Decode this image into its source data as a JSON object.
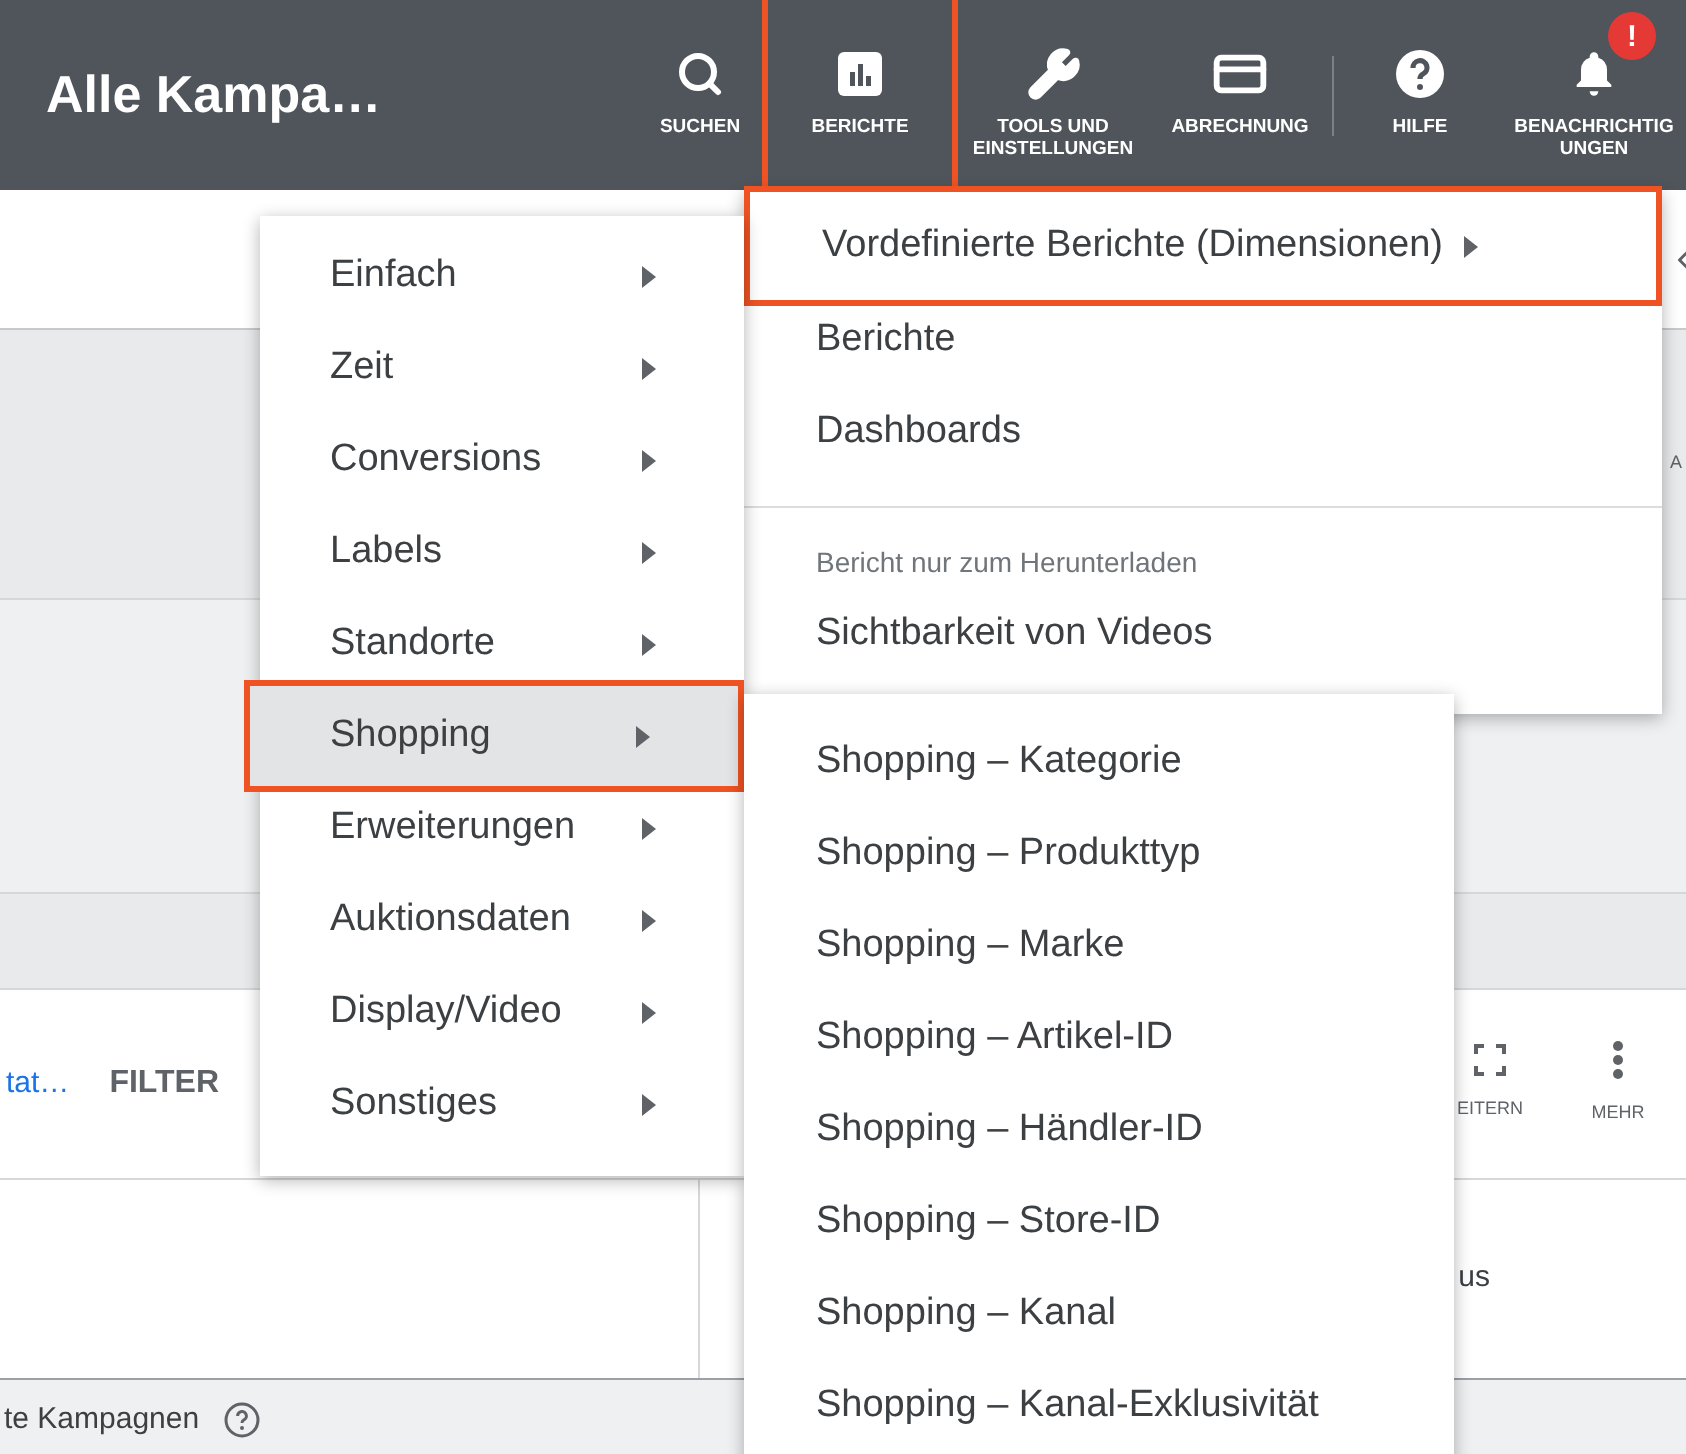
{
  "header": {
    "title": "Alle Kampa…",
    "actions": [
      {
        "kind": "search",
        "label": "SUCHEN",
        "highlighted": false
      },
      {
        "kind": "reports",
        "label": "BERICHTE",
        "highlighted": true
      },
      {
        "kind": "tools",
        "label": "TOOLS UND EINSTELLUNGEN",
        "highlighted": false
      },
      {
        "kind": "billing",
        "label": "ABRECHNUNG",
        "highlighted": false
      },
      {
        "kind": "help",
        "label": "HILFE",
        "highlighted": false
      },
      {
        "kind": "notifications",
        "label": "BENACHRICHTIG UNGEN",
        "highlighted": false,
        "badge": "!"
      }
    ]
  },
  "reports_menu": {
    "items": [
      {
        "kind": "submenu",
        "label": "Vordefinierte Berichte (Dimensionen)",
        "highlighted": true
      },
      {
        "kind": "item",
        "label": "Berichte",
        "highlighted": false
      },
      {
        "kind": "item",
        "label": "Dashboards",
        "highlighted": false
      },
      {
        "kind": "divider"
      },
      {
        "kind": "section",
        "label": "Bericht nur zum Herunterladen"
      },
      {
        "kind": "item",
        "label": "Sichtbarkeit von Videos",
        "highlighted": false
      }
    ]
  },
  "dimensions_menu": {
    "items": [
      {
        "label": "Einfach",
        "selected": false,
        "highlighted": false
      },
      {
        "label": "Zeit",
        "selected": false,
        "highlighted": false
      },
      {
        "label": "Conversions",
        "selected": false,
        "highlighted": false
      },
      {
        "label": "Labels",
        "selected": false,
        "highlighted": false
      },
      {
        "label": "Standorte",
        "selected": false,
        "highlighted": false
      },
      {
        "label": "Shopping",
        "selected": true,
        "highlighted": true
      },
      {
        "label": "Erweiterungen",
        "selected": false,
        "highlighted": false
      },
      {
        "label": "Auktionsdaten",
        "selected": false,
        "highlighted": false
      },
      {
        "label": "Display/Video",
        "selected": false,
        "highlighted": false
      },
      {
        "label": "Sonstiges",
        "selected": false,
        "highlighted": false
      }
    ]
  },
  "shopping_menu": {
    "items": [
      "Shopping – Kategorie",
      "Shopping – Produkttyp",
      "Shopping – Marke",
      "Shopping – Artikel-ID",
      "Shopping – Händler-ID",
      "Shopping – Store-ID",
      "Shopping – Kanal",
      "Shopping – Kanal-Exklusivität"
    ]
  },
  "page": {
    "edge_text": "A",
    "link": "tat…",
    "filter": "FILTER",
    "tools": [
      {
        "kind": "expand",
        "label": "EITERN"
      },
      {
        "kind": "more",
        "label": "MEHR"
      }
    ],
    "cell": "us",
    "footer": "te Kampagnen"
  }
}
